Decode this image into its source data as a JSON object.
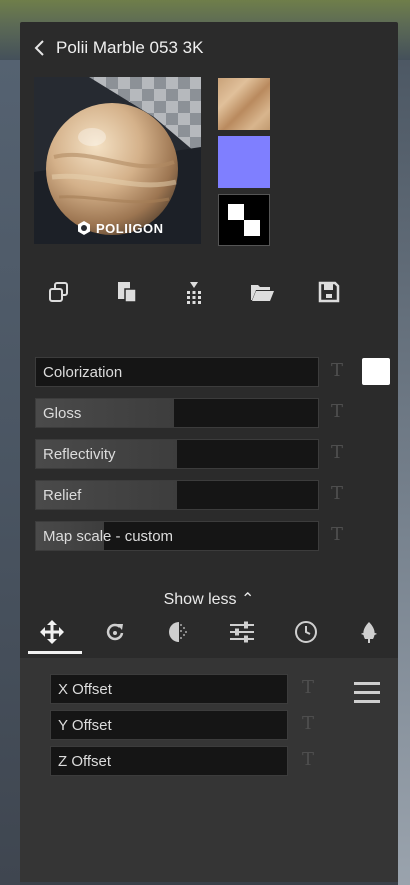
{
  "header": {
    "title": "Polii Marble 053 3K"
  },
  "preview": {
    "logo_text": "POLIIGON"
  },
  "maps": [
    {
      "name": "albedo",
      "color": "#c9a27a"
    },
    {
      "name": "normal",
      "color": "#7f7fff"
    },
    {
      "name": "roughness",
      "color": "#000000"
    }
  ],
  "toolbar": {
    "icons": [
      "copy-icon",
      "paste-icon",
      "apply-icon",
      "folder-open-icon",
      "save-icon"
    ]
  },
  "sliders": [
    {
      "label": "Colorization",
      "fill": 0,
      "t": "T",
      "swatch": "#ffffff"
    },
    {
      "label": "Gloss",
      "fill": 0.49,
      "t": "T"
    },
    {
      "label": "Reflectivity",
      "fill": 0.5,
      "t": "T"
    },
    {
      "label": "Relief",
      "fill": 0.5,
      "t": "T"
    },
    {
      "label": "Map scale - custom",
      "fill": 0.24,
      "t": "T"
    }
  ],
  "show_less": "Show less ⌃",
  "tabs": [
    "move-icon",
    "rotate-icon",
    "shading-icon",
    "adjust-icon",
    "history-icon",
    "leaf-icon"
  ],
  "offsets": [
    {
      "label": "X Offset",
      "t": "T"
    },
    {
      "label": "Y Offset",
      "t": "T"
    },
    {
      "label": "Z Offset",
      "t": "T"
    }
  ],
  "colors": {
    "panel": "#2b2b2b",
    "field": "#151515",
    "accent": "#ffffff"
  }
}
